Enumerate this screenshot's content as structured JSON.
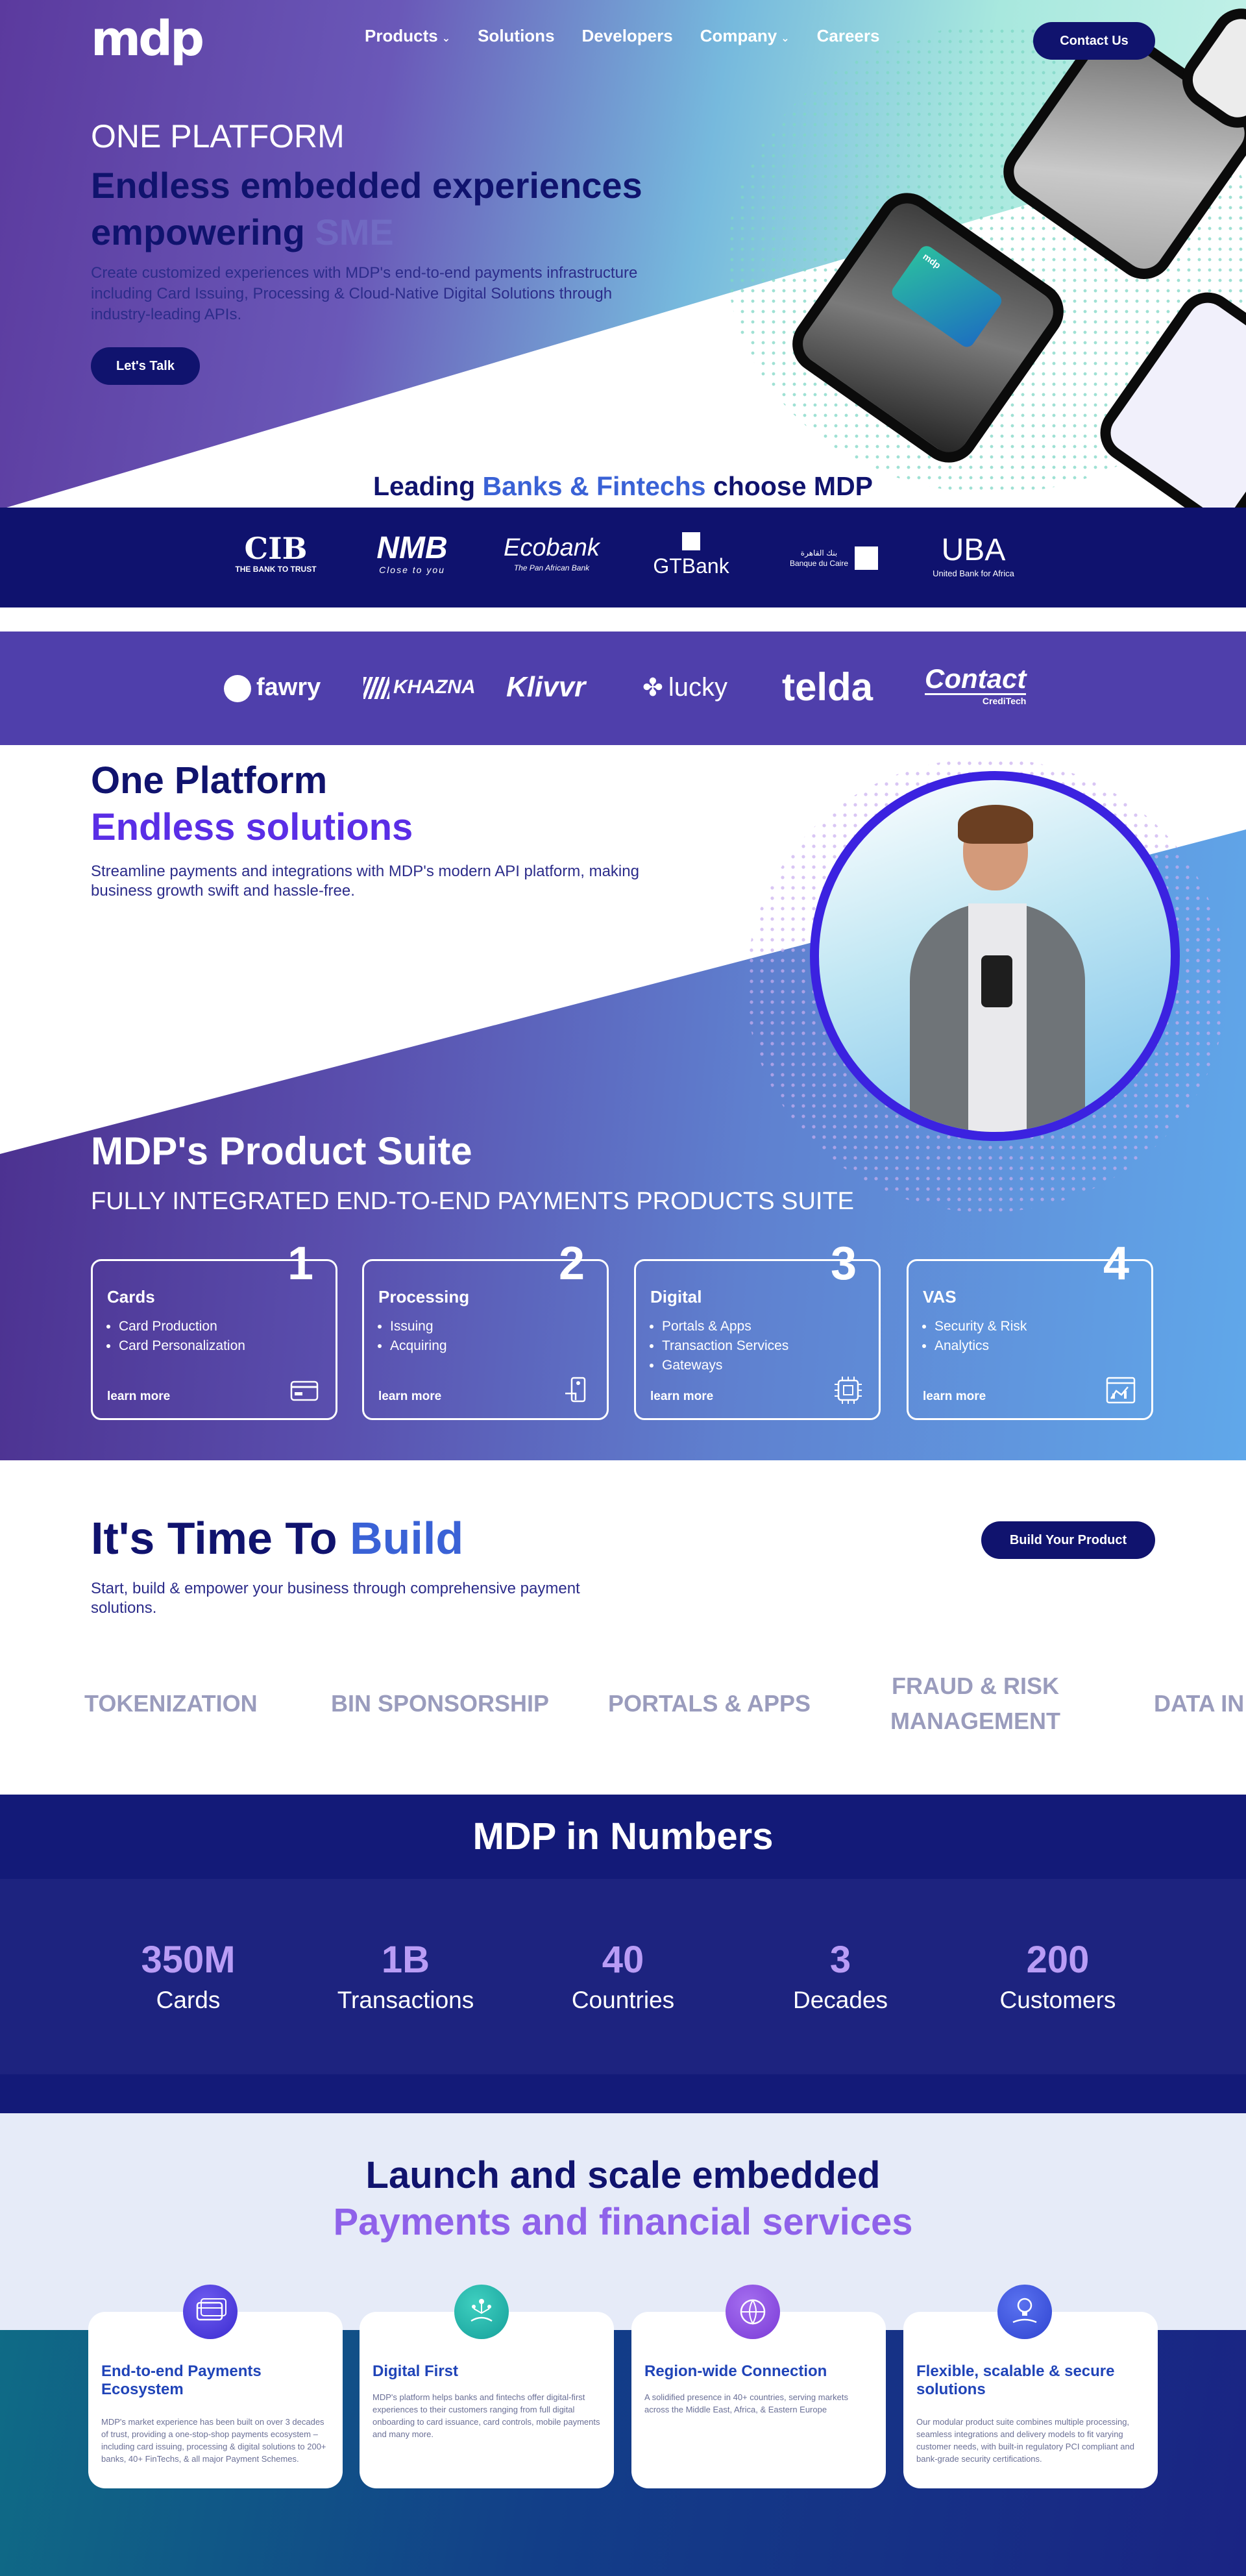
{
  "nav": {
    "logo": "mdp",
    "links": [
      "Products",
      "Solutions",
      "Developers",
      "Company",
      "Careers"
    ],
    "contact_label": "Contact Us"
  },
  "hero": {
    "kicker": "ONE PLATFORM",
    "headline_1": "Endless embedded experiences",
    "headline_2": "empowering",
    "headline_fade": "SME",
    "description": "Create customized experiences with MDP's end-to-end payments infrastructure including Card Issuing, Processing & Cloud-Native Digital Solutions through industry-leading APIs.",
    "cta_label": "Let's Talk",
    "card_text": "mdp"
  },
  "banks_heading": {
    "pre": "Leading ",
    "accent": "Banks & Fintechs",
    "post": " choose MDP"
  },
  "banks": [
    {
      "name": "CIB",
      "tagline": "THE BANK TO TRUST"
    },
    {
      "name": "NMB",
      "tagline": "Close to you"
    },
    {
      "name": "Ecobank",
      "tagline": "The Pan African Bank"
    },
    {
      "name": "GTBank",
      "tagline": ""
    },
    {
      "name": "Banque du Caire",
      "tagline": "بنك القاهرة"
    },
    {
      "name": "UBA",
      "tagline": "United Bank for Africa"
    }
  ],
  "fintechs": [
    "fawry",
    "KHAZNA",
    "Klivvr",
    "lucky",
    "telda",
    "Contact",
    "CrediTech"
  ],
  "platform": {
    "title": "One Platform",
    "accent": "Endless solutions",
    "description": "Streamline payments and integrations with MDP's modern API platform, making business growth swift and hassle-free."
  },
  "product_suite": {
    "title": "MDP's Product Suite",
    "subtitle": "FULLY INTEGRATED END-TO-END PAYMENTS PRODUCTS SUITE",
    "cards": [
      {
        "num": "1",
        "title": "Cards",
        "items": [
          "Card Production",
          "Card Personalization"
        ],
        "link": "learn more",
        "icon": "card-icon"
      },
      {
        "num": "2",
        "title": "Processing",
        "items": [
          "Issuing",
          "Acquiring"
        ],
        "link": "learn more",
        "icon": "processing-icon"
      },
      {
        "num": "3",
        "title": "Digital",
        "items": [
          "Portals & Apps",
          "Transaction Services",
          "Gateways"
        ],
        "link": "learn more",
        "icon": "chip-icon"
      },
      {
        "num": "4",
        "title": "VAS",
        "items": [
          "Security & Risk",
          "Analytics"
        ],
        "link": "learn more",
        "icon": "analytics-icon"
      }
    ]
  },
  "build": {
    "title_1": "It's Time To ",
    "title_accent": "Build",
    "description": "Start, build & empower your business through comprehensive payment solutions.",
    "cta_label": "Build Your Product",
    "chips": [
      "TOKENIZATION",
      "BIN SPONSORSHIP",
      "PORTALS & APPS",
      "FRAUD & RISK",
      "MANAGEMENT",
      "DATA IN"
    ]
  },
  "numbers": {
    "title": "MDP in Numbers",
    "stats": [
      {
        "value": "350M",
        "label": "Cards"
      },
      {
        "value": "1B",
        "label": "Transactions"
      },
      {
        "value": "40",
        "label": "Countries"
      },
      {
        "value": "3",
        "label": "Decades"
      },
      {
        "value": "200",
        "label": "Customers"
      }
    ]
  },
  "launch": {
    "title_1": "Launch and scale embedded",
    "title_2": "Payments and financial services",
    "cards": [
      {
        "title": "End-to-end Payments Ecosystem",
        "text": "MDP's market experience has been built on over 3 decades of trust, providing a one-stop-shop payments ecosystem – including card issuing, processing & digital solutions to 200+ banks, 40+ FinTechs, & all major Payment Schemes.",
        "icon": "cards-stack-icon"
      },
      {
        "title": "Digital First",
        "text": "MDP's platform helps banks and fintechs offer digital-first experiences to their customers ranging from full digital onboarding to card issuance, card controls, mobile payments and many more.",
        "icon": "network-hand-icon"
      },
      {
        "title": "Region-wide Connection",
        "text": "A solidified presence in 40+ countries, serving markets across the Middle East, Africa, & Eastern Europe",
        "icon": "globe-pin-icon"
      },
      {
        "title": "Flexible, scalable & secure solutions",
        "text": "Our modular product suite combines multiple processing, seamless integrations and delivery models to fit varying customer needs, with built-in regulatory PCI compliant and bank-grade security certifications.",
        "icon": "lightbulb-hand-icon"
      }
    ]
  },
  "colors": {
    "navy": "#10136e",
    "accent_blue": "#3a62d6",
    "accent_violet": "#5a2ee6",
    "stat_violet": "#b99cf5",
    "chip_gray": "#9a9cbd"
  }
}
